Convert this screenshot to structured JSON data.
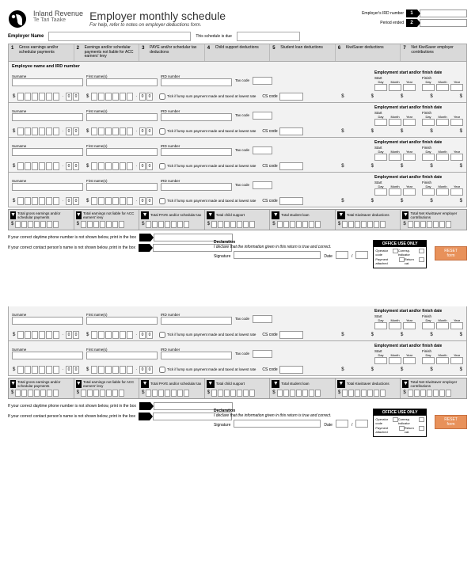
{
  "brand": {
    "main": "Inland Revenue",
    "sub": "Te Tari Taake"
  },
  "header": {
    "title": "Employer monthly schedule",
    "subtitle": "For help, refer to notes on employer deductions form.",
    "ird_label": "Employer's IRD number",
    "period_label": "Period ended",
    "badge1": "1",
    "badge2": "2"
  },
  "employer": {
    "label": "Employer Name",
    "due_label": "This schedule is due"
  },
  "columns": [
    {
      "n": "1",
      "t": "Gross earnings and/or schedular payments"
    },
    {
      "n": "2",
      "t": "Earnings and/or schedular payments not liable for ACC earners' levy"
    },
    {
      "n": "3",
      "t": "PAYE and/or schedular tax deductions"
    },
    {
      "n": "4",
      "t": "Child support deductions"
    },
    {
      "n": "5",
      "t": "Student loan deductions"
    },
    {
      "n": "6",
      "t": "KiwiSaver deductions"
    },
    {
      "n": "7",
      "t": "Net KiwiSaver employer contributions"
    }
  ],
  "emp_section_title": "Employee name and IRD number",
  "labels": {
    "surname": "Surname",
    "first": "First name(s)",
    "ird": "IRD number",
    "tax": "Tax code",
    "cs": "CS code",
    "lump": "Tick if lump sum payment made and taxed at lowest rate",
    "emp_dates": "Employment start and/or finish date",
    "start": "Start",
    "finish": "Finish",
    "day": "Day",
    "month": "Month",
    "year": "Year",
    "cents": "00",
    "dollar": "$"
  },
  "totals": [
    "Total gross earnings and/or schedular payments",
    "Total earnings not liable for ACC earners' levy",
    "Total PAYE and/or schedular tax",
    "Total child support",
    "Total student loan",
    "Total KiwiSaver deductions",
    "Total Net KiwiSaver employer contributions"
  ],
  "contact": {
    "phone": "If your correct daytime phone number is not shown below, print in the box",
    "person": "If your correct contact person's name is not shown below, print in the box"
  },
  "declaration": {
    "head": "Declaration",
    "text": "I declare that the information given in this return is true and correct.",
    "sig": "Signature",
    "date": "Date",
    "slash": "/"
  },
  "office": {
    "head": "OFFICE USE ONLY",
    "rows": [
      [
        "Operator code",
        "Corresp. indicator"
      ],
      [
        "Payment attached",
        "Return cat."
      ]
    ]
  },
  "reset": "RESET form"
}
